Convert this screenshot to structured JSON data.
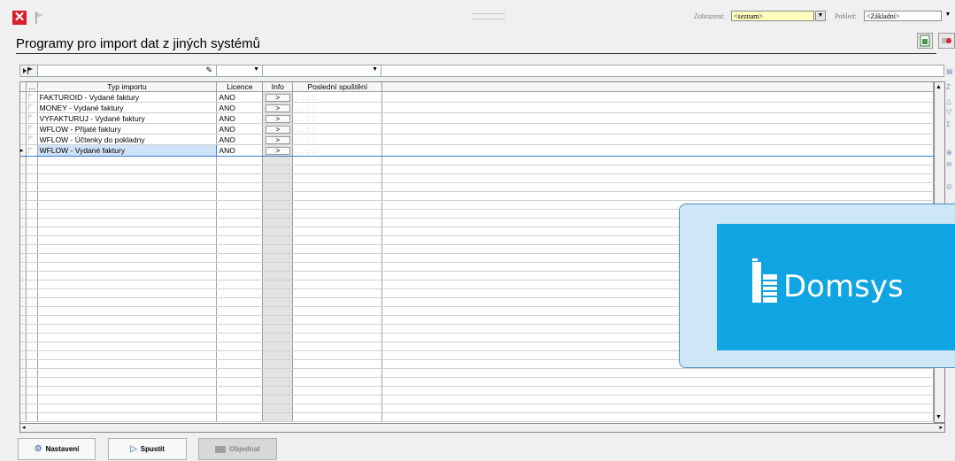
{
  "page": {
    "title": "Programy pro import dat z jiných systémů"
  },
  "topbar": {
    "zobrazeni_label": "Zobrazení:",
    "zobrazeni_value": "<seznam>",
    "pohled_label": "Pohled:",
    "pohled_value": "<Základní>"
  },
  "grid": {
    "columns": [
      "...",
      "Typ importu",
      "Licence",
      "Info",
      "Poslední spuštění"
    ],
    "rows": [
      {
        "type": "FAKTUROID - Vydané faktury",
        "licence": "ANO",
        "info": ">",
        "last": ". .   : :",
        "current": false
      },
      {
        "type": "MONEY - Vydané faktury",
        "licence": "ANO",
        "info": ">",
        "last": ". .   : :",
        "current": false
      },
      {
        "type": "VYFAKTURUJ - Vydané faktury",
        "licence": "ANO",
        "info": ">",
        "last": ". .   : :",
        "current": false
      },
      {
        "type": "WFLOW - Přijaté faktury",
        "licence": "ANO",
        "info": ">",
        "last": ". .   : :",
        "current": false
      },
      {
        "type": "WFLOW - Účtenky do pokladny",
        "licence": "ANO",
        "info": ">",
        "last": ". .   : :",
        "current": false
      },
      {
        "type": "WFLOW - Vydané faktury",
        "licence": "ANO",
        "info": ">",
        "last": ". .   : :",
        "current": true
      }
    ]
  },
  "overlay": {
    "logo_text": "Domsys",
    "brand_color": "#10a5e2"
  },
  "buttons": {
    "settings": "Nastavení",
    "run": "Spustit",
    "order": "Objednat"
  }
}
